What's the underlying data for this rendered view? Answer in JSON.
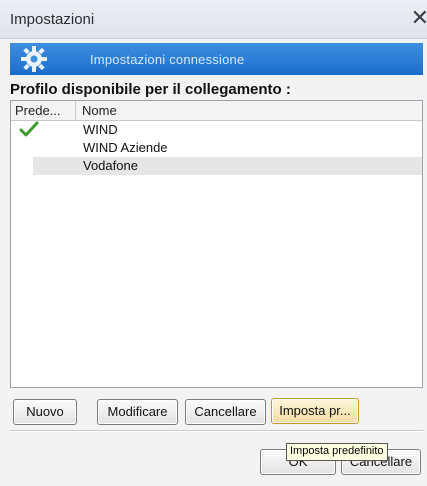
{
  "window": {
    "title": "Impostazioni",
    "close_glyph": "✕"
  },
  "banner": {
    "icon": "gear-icon",
    "text": "Impostazioni connessione",
    "accent": "#1a6fcc"
  },
  "section": {
    "title": "Profilo disponibile per il collegamento :"
  },
  "profiles": {
    "columns": [
      "Prede...",
      "Nome"
    ],
    "rows": [
      {
        "default": true,
        "name": "WIND"
      },
      {
        "default": false,
        "name": "WIND Aziende"
      },
      {
        "default": false,
        "name": "Vodafone",
        "selected": true
      }
    ]
  },
  "buttons": {
    "new": "Nuovo",
    "edit": "Modificare",
    "delete": "Cancellare",
    "set_default": "Imposta pr...",
    "ok": "OK",
    "cancel": "Cancellare"
  },
  "tooltip": {
    "text": "Imposta predefinito"
  }
}
